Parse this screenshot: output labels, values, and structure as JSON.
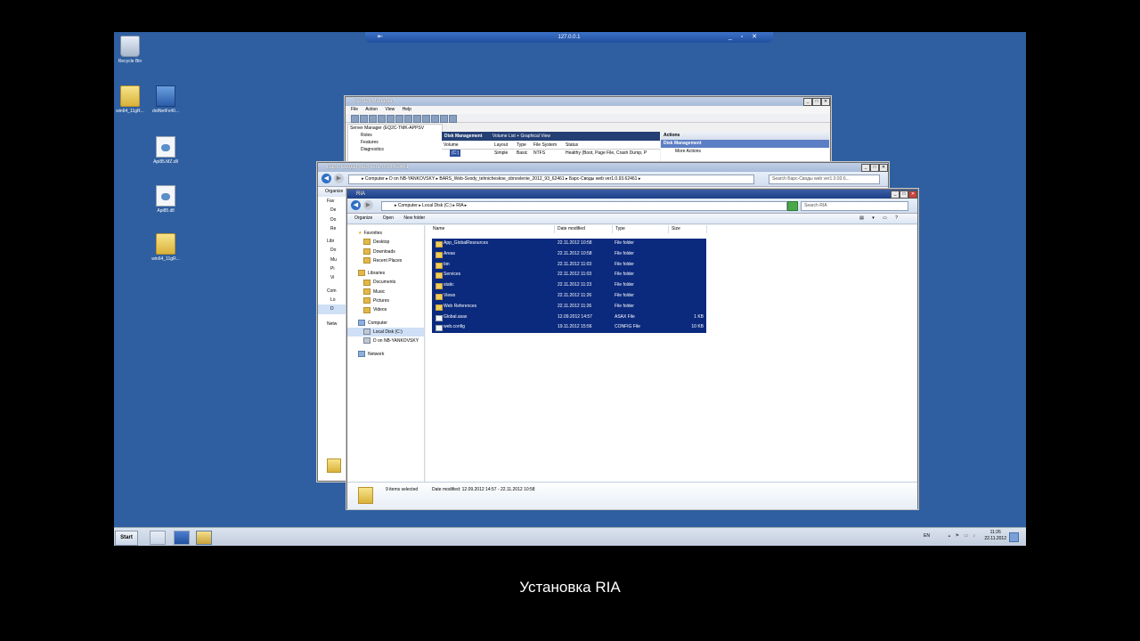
{
  "rdp_bar": {
    "title": "127.0.0.1"
  },
  "desktop_icons": [
    {
      "label": "Recycle Bin",
      "icon": "recycle-bin-icon"
    },
    {
      "label": "win64_11gR...",
      "icon": "folder-icon"
    },
    {
      "label": "dotNetFx40...",
      "icon": "setup-icon"
    },
    {
      "label": "Api85.MZ.dll",
      "icon": "dll-icon"
    },
    {
      "label": "Api85.dll",
      "icon": "dll-icon"
    },
    {
      "label": "win64_11gR...",
      "icon": "folder-icon"
    }
  ],
  "server_manager": {
    "title": "Server Manager",
    "menu": [
      "File",
      "Action",
      "View",
      "Help"
    ],
    "tree": [
      "Server Manager (EQ2C-TMK-APPSV",
      "Roles",
      "Features",
      "Diagnostics"
    ],
    "panel_title": "Disk Management",
    "panel_subtitle": "Volume List + Graphical View",
    "columns": [
      "Volume",
      "Layout",
      "Type",
      "File System",
      "Status"
    ],
    "row": {
      "volume": "(C:)",
      "layout": "Simple",
      "type": "Basic",
      "fs": "NTFS",
      "status": "Healthy (Boot, Page File, Crash Dump, P"
    },
    "actions_header": "Actions",
    "actions_section": "Disk Management",
    "actions_more": "More Actions"
  },
  "explorer_back": {
    "title": "Барс-Своды web ver1.0.93.62461",
    "address": "▸ Computer ▸ D on NB-YANKOVSKY ▸ BARS_Web-Svody_tehnicheskoe_obnovlenie_2012_93_62461 ▸ Барс-Своды web ver1.0.93.62461 ▸",
    "search": "Search Барс-Своды web ver1.0.93.6...",
    "organize": "Organize",
    "nav_stubs": [
      "Fav",
      "De",
      "Do",
      "Re",
      "Libr",
      "Do",
      "Mu",
      "Pi",
      "Vi",
      "Com",
      "Lo",
      "D",
      "Netw"
    ]
  },
  "explorer_front": {
    "title": "RIA",
    "address": "▸ Computer ▸ Local Disk (C:) ▸ RIA ▸",
    "search_placeholder": "Search RIA",
    "cmd": {
      "organize": "Organize",
      "open": "Open",
      "new_folder": "New folder"
    },
    "nav": {
      "favorites": "Favorites",
      "fav_items": [
        "Desktop",
        "Downloads",
        "Recent Places"
      ],
      "libraries": "Libraries",
      "lib_items": [
        "Documents",
        "Music",
        "Pictures",
        "Videos"
      ],
      "computer": "Computer",
      "comp_items": [
        "Local Disk (C:)",
        "D on NB-YANKOVSKY"
      ],
      "network": "Network"
    },
    "columns": [
      "Name",
      "Date modified",
      "Type",
      "Size"
    ],
    "files": [
      {
        "name": "App_GlobalResources",
        "date": "22.11.2012 10:58",
        "type": "File folder",
        "size": ""
      },
      {
        "name": "Areas",
        "date": "22.11.2012 10:58",
        "type": "File folder",
        "size": ""
      },
      {
        "name": "bin",
        "date": "22.11.2012 11:03",
        "type": "File folder",
        "size": ""
      },
      {
        "name": "Services",
        "date": "22.11.2012 11:03",
        "type": "File folder",
        "size": ""
      },
      {
        "name": "static",
        "date": "22.11.2012 11:23",
        "type": "File folder",
        "size": ""
      },
      {
        "name": "Views",
        "date": "22.11.2012 11:26",
        "type": "File folder",
        "size": ""
      },
      {
        "name": "Web References",
        "date": "22.11.2012 11:26",
        "type": "File folder",
        "size": ""
      },
      {
        "name": "Global.asax",
        "date": "12.09.2012 14:57",
        "type": "ASAX File",
        "size": "1 KB"
      },
      {
        "name": "web.config",
        "date": "19.11.2012 15:56",
        "type": "CONFIG File",
        "size": "10 KB"
      }
    ],
    "details": {
      "selected": "9 items selected",
      "date_label": "Date modified: 12.09.2012 14:57 - 22.11.2012 10:58"
    }
  },
  "taskbar": {
    "start": "Start",
    "lang": "EN",
    "time": "11:26",
    "date": "22.11.2012"
  },
  "caption": "Установка RIA"
}
